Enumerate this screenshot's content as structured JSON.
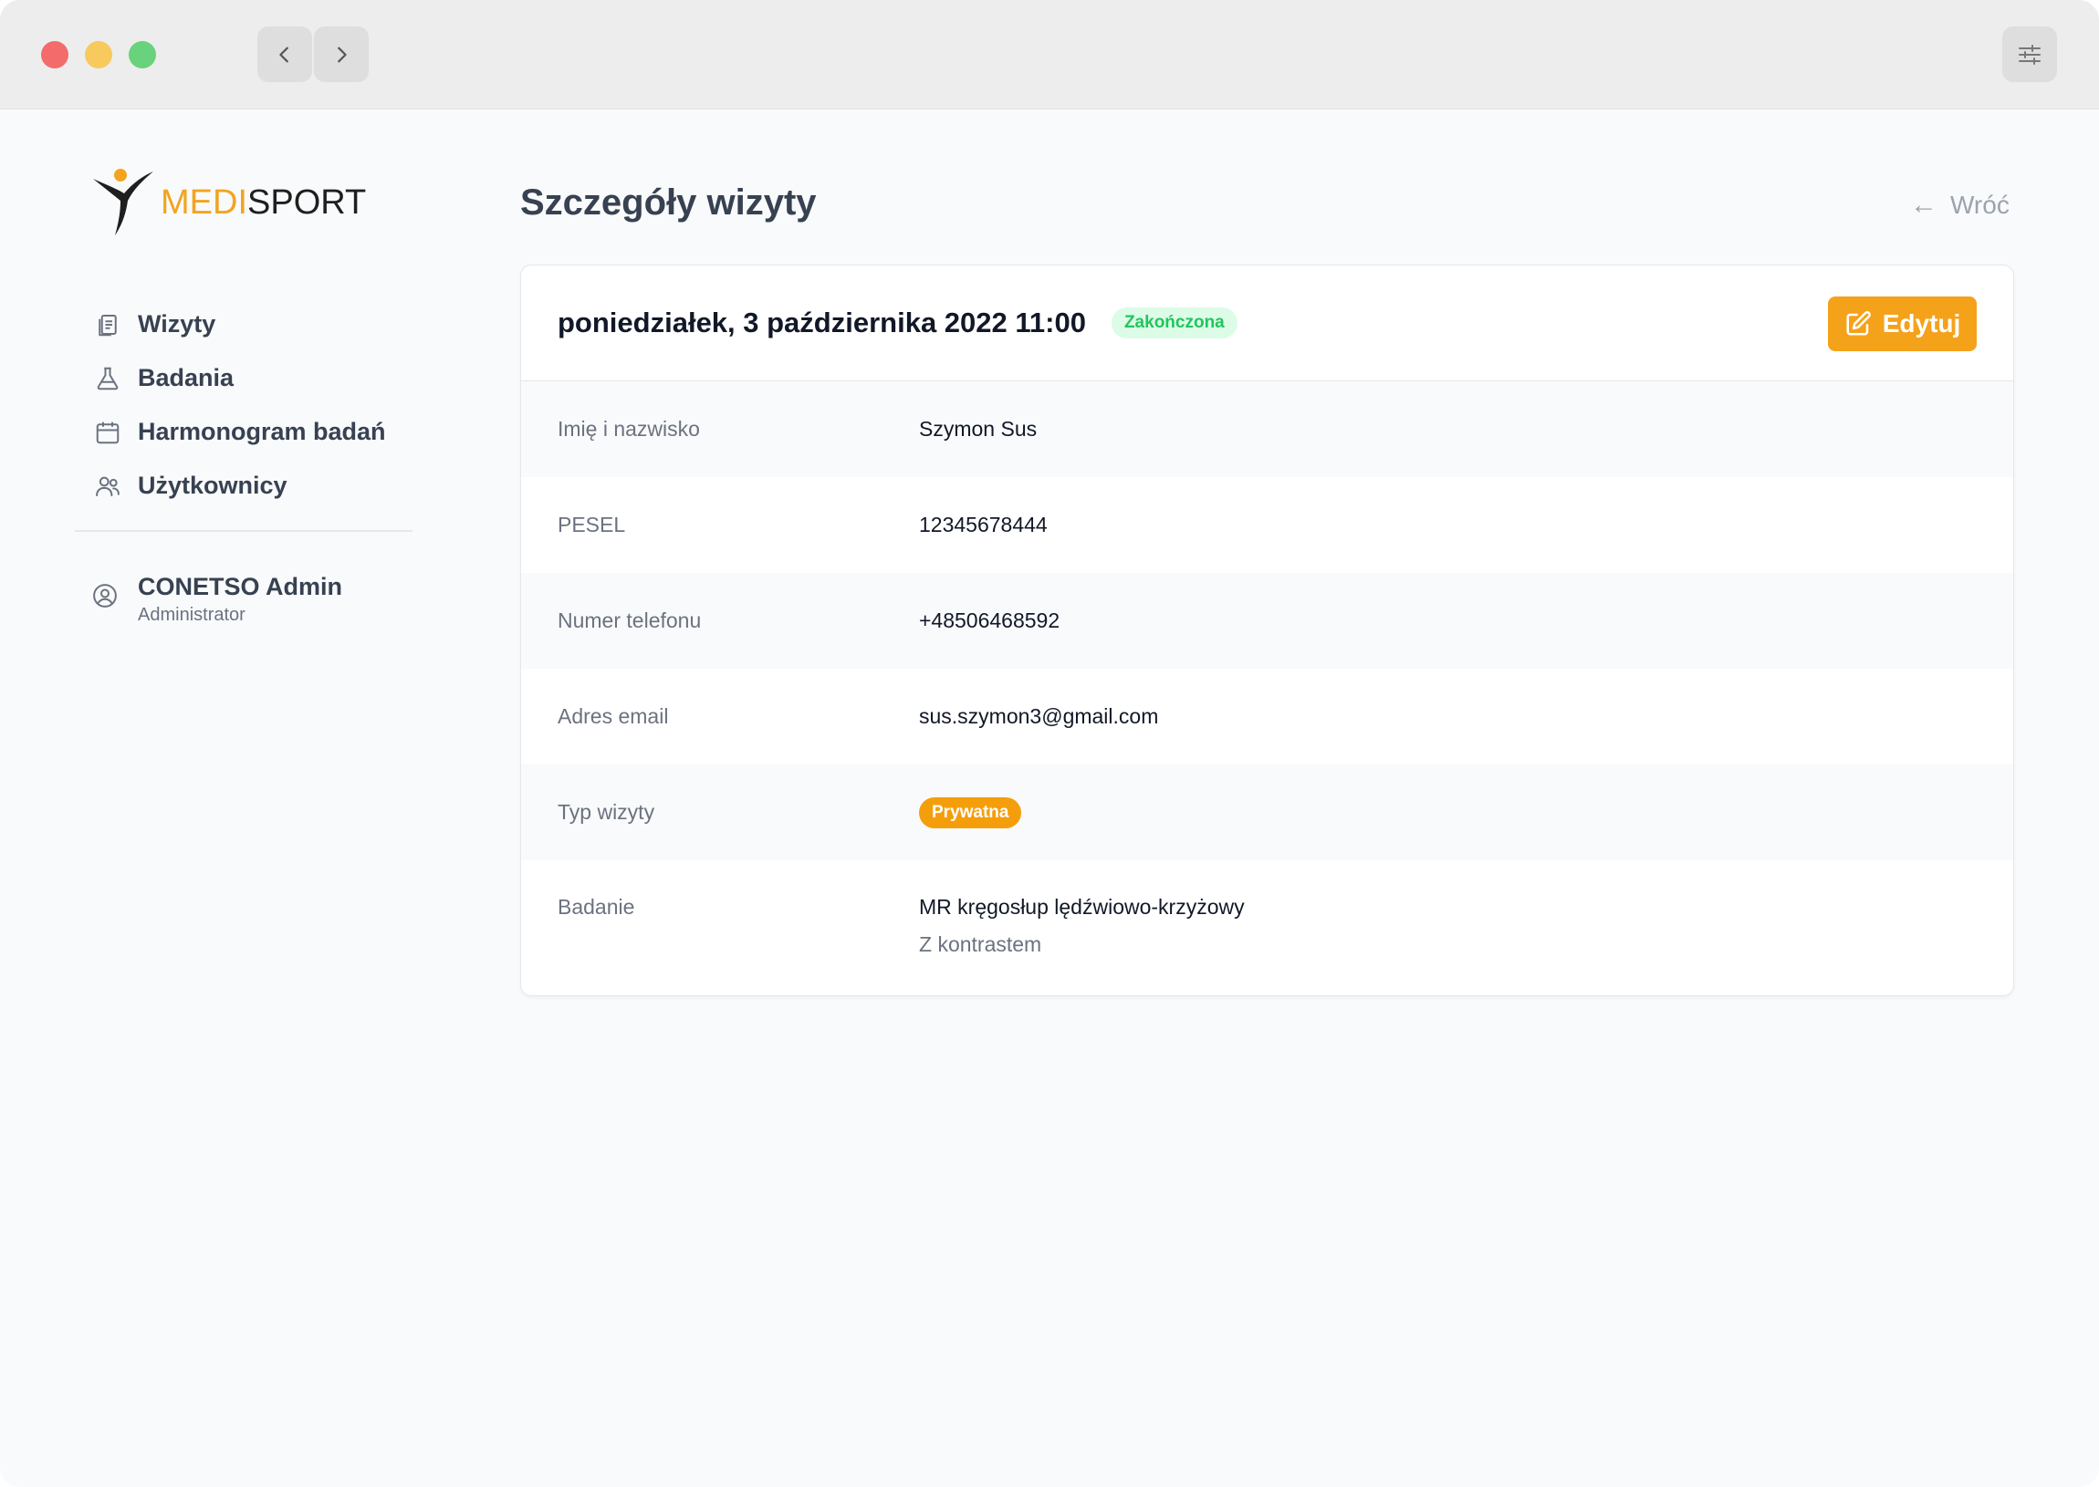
{
  "app": {
    "logo": {
      "part1": "MEDI",
      "part2": "SPORT"
    },
    "brand_color": "#f2a420"
  },
  "sidebar": {
    "items": [
      {
        "label": "Wizyty",
        "icon": "clipboard-icon"
      },
      {
        "label": "Badania",
        "icon": "flask-icon"
      },
      {
        "label": "Harmonogram badań",
        "icon": "calendar-icon"
      },
      {
        "label": "Użytkownicy",
        "icon": "users-icon"
      }
    ],
    "user": {
      "name": "CONETSO Admin",
      "role": "Administrator",
      "icon": "user-circle-icon"
    }
  },
  "main": {
    "title": "Szczegóły wizyty",
    "back_label": "Wróć"
  },
  "card": {
    "date": "poniedziałek, 3 października 2022 11:00",
    "status": "Zakończona",
    "status_color": "#22c55e",
    "edit_label": "Edytuj",
    "accent_color": "#f5a21b",
    "rows": [
      {
        "label": "Imię i nazwisko",
        "value": "Szymon Sus"
      },
      {
        "label": "PESEL",
        "value": "12345678444"
      },
      {
        "label": "Numer telefonu",
        "value": "+48506468592"
      },
      {
        "label": "Adres email",
        "value": "sus.szymon3@gmail.com"
      },
      {
        "label": "Typ wizyty",
        "value": "Prywatna"
      },
      {
        "label": "Badanie",
        "value": "MR kręgosłup lędźwiowo-krzyżowy",
        "sub": "Z kontrastem"
      }
    ]
  }
}
